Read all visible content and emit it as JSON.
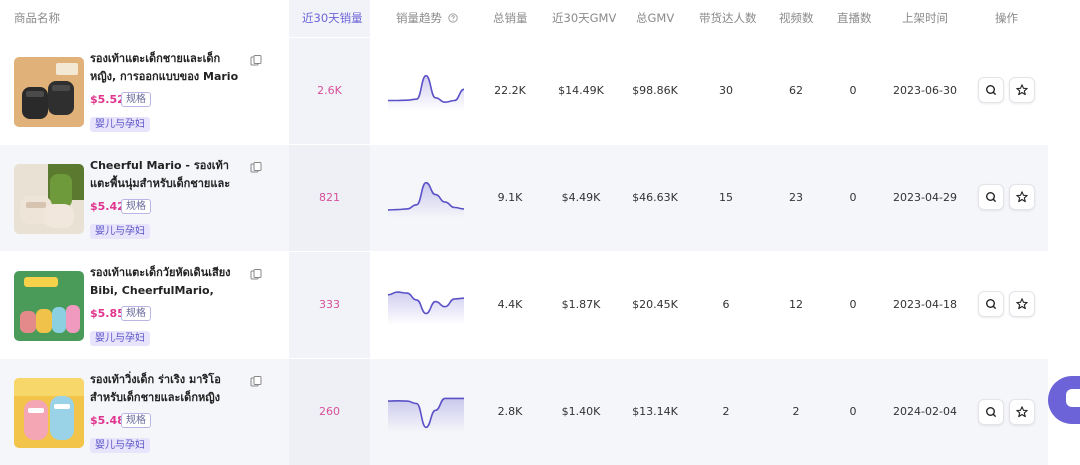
{
  "header": {
    "product": "商品名称",
    "sales30": "近30天销量",
    "trend": "销量趋势",
    "total_sales": "总销量",
    "gmv30": "近30天GMV",
    "total_gmv": "总GMV",
    "creators": "带货达人数",
    "videos": "视频数",
    "lives": "直播数",
    "listed": "上架时间",
    "actions": "操作"
  },
  "rows": [
    {
      "title": "รองเท้าแตะเด็กชายและเด็กหญิง, การออกแบบของ Mario ยินดี,...",
      "price": "$5.52",
      "spec": "规格",
      "category": "婴儿与孕妇",
      "sales30": "2.6K",
      "trend": [
        0.78,
        0.78,
        0.77,
        0.74,
        0.05,
        0.7,
        0.83,
        0.78,
        0.45
      ],
      "total_sales": "22.2K",
      "gmv30": "$14.49K",
      "total_gmv": "$98.86K",
      "creators": "30",
      "videos": "62",
      "lives": "0",
      "listed": "2023-06-30",
      "thumb_color": "#e0b27a"
    },
    {
      "title": "Cheerful Mario - รองเท้าแตะพื้นนุ่มสำหรับเด็กชายและเด็กหญิง...",
      "price": "$5.42",
      "spec": "规格",
      "category": "婴儿与孕妇",
      "sales30": "821",
      "trend": [
        0.85,
        0.84,
        0.82,
        0.7,
        0.05,
        0.4,
        0.62,
        0.78,
        0.82
      ],
      "total_sales": "9.1K",
      "gmv30": "$4.49K",
      "total_gmv": "$46.63K",
      "creators": "15",
      "videos": "23",
      "lives": "0",
      "listed": "2023-04-29",
      "thumb_color": "#6b8a3a"
    },
    {
      "title": "รองเท้าแตะเด็กวัยหัดเดินเสียง Bibi, CheerfulMario, แฟชั่น,...",
      "price": "$5.85",
      "spec": "规格",
      "category": "婴儿与孕妇",
      "sales30": "333",
      "trend": [
        0.2,
        0.12,
        0.15,
        0.35,
        0.75,
        0.4,
        0.55,
        0.32,
        0.3
      ],
      "total_sales": "4.4K",
      "gmv30": "$1.87K",
      "total_gmv": "$20.45K",
      "creators": "6",
      "videos": "12",
      "lives": "0",
      "listed": "2023-04-18",
      "thumb_color": "#4a9a5a"
    },
    {
      "title": "รองเท้าวิ่งเด็ก ร่าเริง มาริโอ สำหรับเด็กชายและเด็กหญิง รองเท้าสัน...",
      "price": "$5.48",
      "spec": "规格",
      "category": "婴儿与孕妇",
      "sales30": "260",
      "trend": [
        0.18,
        0.17,
        0.18,
        0.25,
        0.95,
        0.45,
        0.1,
        0.1,
        0.1
      ],
      "total_sales": "2.8K",
      "gmv30": "$1.40K",
      "total_gmv": "$13.14K",
      "creators": "2",
      "videos": "2",
      "lives": "0",
      "listed": "2024-02-04",
      "thumb_color": "#e7b84a"
    }
  ],
  "colors": {
    "accent": "#6c63d8",
    "sales_pink": "#d6509a",
    "price_pink": "#e0358f",
    "trend_line": "#5b52c8"
  },
  "icons": {
    "copy": "copy-icon",
    "help": "question-circle-icon",
    "search": "search-icon",
    "favorite": "star-icon",
    "chat": "chat-bubble-icon"
  }
}
